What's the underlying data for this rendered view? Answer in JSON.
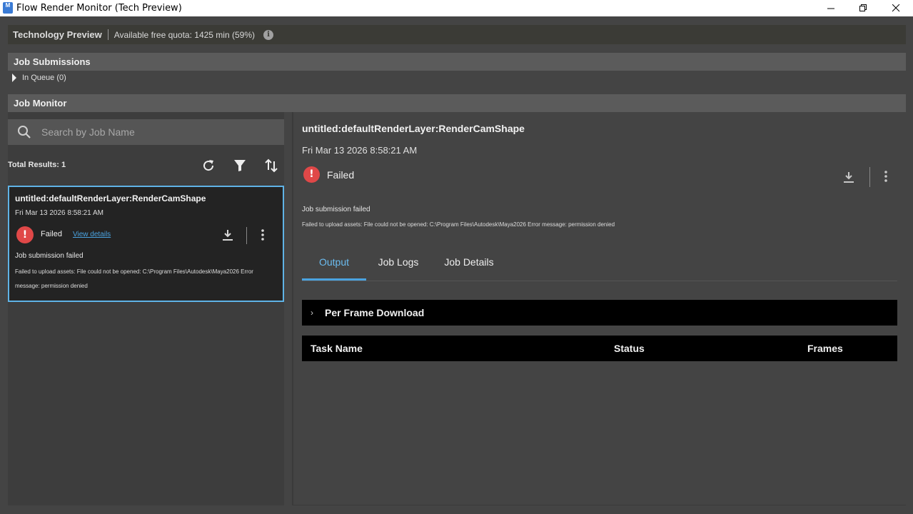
{
  "window": {
    "title": "Flow Render Monitor (Tech Preview)"
  },
  "banner": {
    "title": "Technology Preview",
    "quota": "Available free quota: 1425 min (59%)",
    "info_icon": "info-icon"
  },
  "submissions": {
    "header": "Job Submissions",
    "in_queue": "In Queue (0)"
  },
  "monitor": {
    "header": "Job Monitor",
    "search_placeholder": "Search by Job Name",
    "total_results": "Total Results: 1",
    "tools": [
      "refresh-icon",
      "filter-icon",
      "sort-icon"
    ]
  },
  "job_card": {
    "name": "untitled:defaultRenderLayer:RenderCamShape",
    "date": "Fri Mar 13 2026 8:58:21 AM",
    "status": "Failed",
    "view_details": "View details",
    "message": "Job submission failed",
    "detail": "Failed to upload assets: File could not be opened: C:\\Program Files\\Autodesk\\Maya2026 Error message: permission denied"
  },
  "detail_panel": {
    "title": "untitled:defaultRenderLayer:RenderCamShape",
    "date": "Fri Mar 13 2026 8:58:21 AM",
    "status": "Failed",
    "message": "Job submission failed",
    "detail": "Failed to upload assets: File could not be opened: C:\\Program Files\\Autodesk\\Maya2026 Error message: permission denied",
    "tabs": [
      {
        "label": "Output",
        "active": true
      },
      {
        "label": "Job Logs",
        "active": false
      },
      {
        "label": "Job Details",
        "active": false
      }
    ],
    "per_frame_download": "Per Frame Download",
    "table_columns": [
      "Task Name",
      "Status",
      "Frames"
    ]
  },
  "colors": {
    "accent": "#4aa3e0",
    "error": "#e04848",
    "card_border": "#5fb3e6"
  }
}
